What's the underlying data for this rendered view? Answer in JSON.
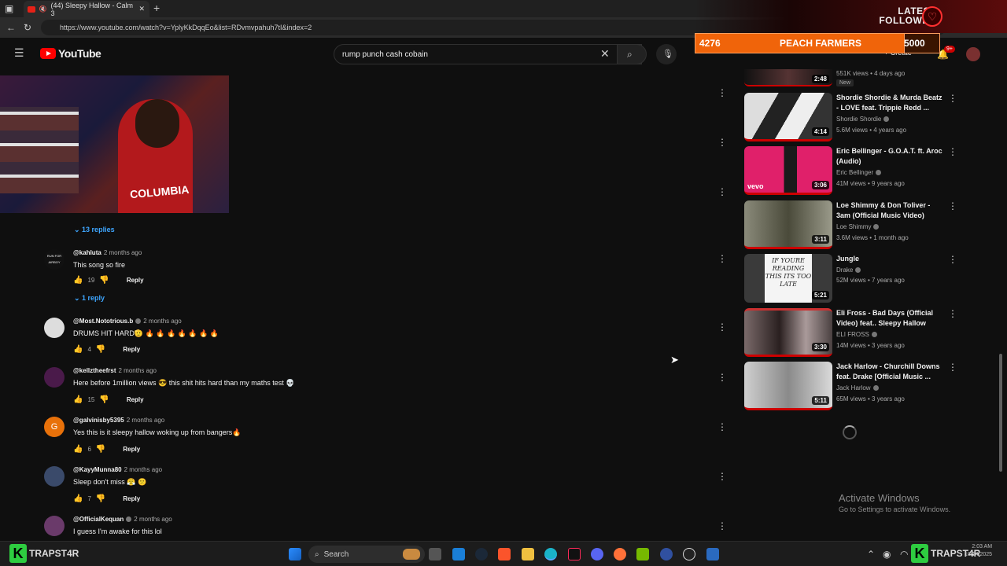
{
  "browser": {
    "tab_title": "(44) Sleepy Hallow - Calm 3",
    "url": "https://www.youtube.com/watch?v=YplyKkDqqEo&list=RDvmvpahuh7tI&index=2"
  },
  "youtube": {
    "logo_text": "YouTube",
    "search_query": "rump punch cash cobain",
    "create_label": "Create",
    "notif_count": "9+"
  },
  "overlay": {
    "latest_line1": "LATEST",
    "latest_line2": "FOLLOWER",
    "goal_current": "4276",
    "goal_name": "PEACH FARMERS",
    "goal_target": "5000",
    "goal_progress": 0.8552
  },
  "webcam": {
    "shirt_text": "COLUMBIA"
  },
  "comments": [
    {
      "replies": "13 replies"
    },
    {
      "avatar": "RUN FOR AIRBOY",
      "author": "@kahluta",
      "time": "2 months ago",
      "text": "This song so fire",
      "likes": "19",
      "reply": "Reply",
      "replies": "1 reply"
    },
    {
      "avatar": "",
      "author": "@Most.Nototrious.b",
      "time": "2 months ago",
      "text": "DRUMS HIT HARD🫡 🔥 🔥 🔥 🔥 🔥 🔥 🔥",
      "likes": "4",
      "reply": "Reply"
    },
    {
      "avatar": "",
      "author": "@kellztheefrst",
      "time": "2 months ago",
      "text": "Here before 1million views 😎 this shit hits hard than my maths test 💀",
      "likes": "15",
      "reply": "Reply"
    },
    {
      "avatar": "G",
      "author": "@galvinisby5395",
      "time": "2 months ago",
      "text": "Yes this is it sleepy hallow woking up from bangers🔥",
      "likes": "6",
      "reply": "Reply"
    },
    {
      "avatar": "",
      "author": "@KayyMunna80",
      "time": "2 months ago",
      "text": "Sleep don't miss 😤 😕",
      "likes": "7",
      "reply": "Reply"
    },
    {
      "avatar": "",
      "author": "@OfficialKequan",
      "time": "2 months ago",
      "text": "I guess I'm awake for this lol"
    }
  ],
  "sidebar": [
    {
      "duration": "2:48",
      "meta": "551K views • 4 days ago",
      "badge": "New"
    },
    {
      "title": "Shordie Shordie & Murda Beatz - LOVE feat. Trippie Redd ...",
      "channel": "Shordie Shordie",
      "meta": "5.6M views • 4 years ago",
      "duration": "4:14"
    },
    {
      "title": "Eric Bellinger - G.O.A.T. ft. Aroc (Audio)",
      "channel": "Eric Bellinger",
      "meta": "41M views • 9 years ago",
      "duration": "3:06"
    },
    {
      "title": "Loe Shimmy & Don Toliver - 3am (Official Music Video)",
      "channel": "Loe Shimmy",
      "meta": "3.6M views • 1 month ago",
      "duration": "3:11"
    },
    {
      "title": "Jungle",
      "channel": "Drake",
      "meta": "52M views • 7 years ago",
      "duration": "5:21"
    },
    {
      "title": "Eli Fross - Bad Days (Official Video) feat.. Sleepy Hallow",
      "channel": "ELI FROSS",
      "meta": "14M views • 3 years ago",
      "duration": "3:30"
    },
    {
      "title": "Jack Harlow - Churchill Downs feat. Drake [Official Music ...",
      "channel": "Jack Harlow",
      "meta": "65M views • 3 years ago",
      "duration": "5:11"
    }
  ],
  "thumb_text": {
    "jungle": "IF YOURE READING THIS ITS TOO LATE",
    "vevo": "vevo"
  },
  "windows": {
    "activate_title": "Activate Windows",
    "activate_sub": "Go to Settings to activate Windows.",
    "taskbar_search": "Search",
    "trap_label": "TRAPST4R",
    "clock_time": "2:03 AM",
    "clock_date": "10/14/2025"
  },
  "colors": {
    "accent_link": "#3ea6ff",
    "goal_bar": "#f0640a",
    "yt_red": "#ff0000"
  }
}
